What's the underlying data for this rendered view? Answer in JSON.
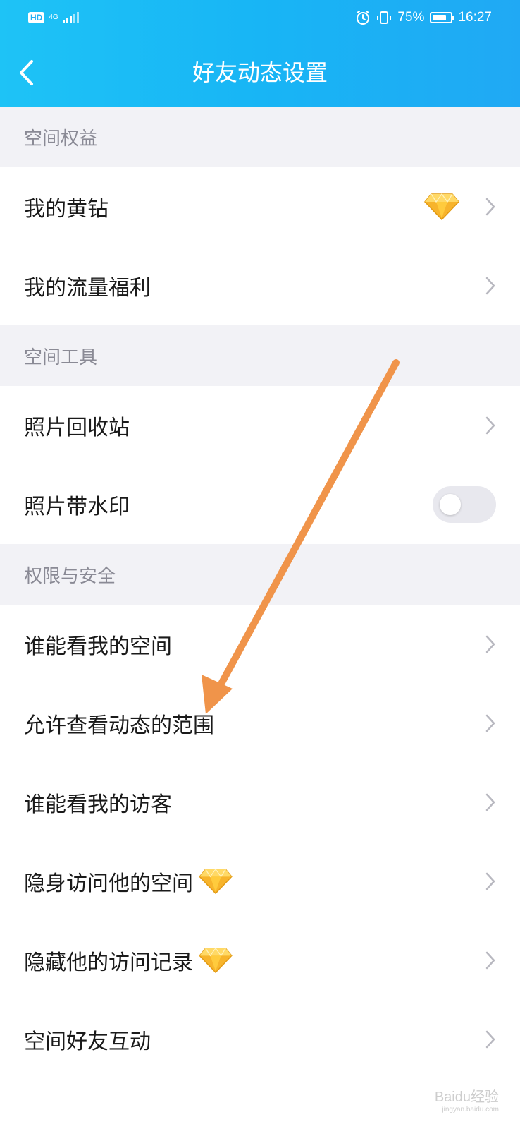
{
  "status_bar": {
    "hd": "HD",
    "network": "4G",
    "battery": "75%",
    "time": "16:27"
  },
  "header": {
    "title": "好友动态设置"
  },
  "sections": [
    {
      "title": "空间权益",
      "items": [
        {
          "label": "我的黄钻",
          "badge": "diamond-icon"
        },
        {
          "label": "我的流量福利"
        }
      ]
    },
    {
      "title": "空间工具",
      "items": [
        {
          "label": "照片回收站"
        },
        {
          "label": "照片带水印",
          "toggle": "off"
        }
      ]
    },
    {
      "title": "权限与安全",
      "items": [
        {
          "label": "谁能看我的空间"
        },
        {
          "label": "允许查看动态的范围"
        },
        {
          "label": "谁能看我的访客"
        },
        {
          "label": "隐身访问他的空间",
          "badge": "diamond-icon"
        },
        {
          "label": "隐藏他的访问记录",
          "badge": "diamond-icon"
        },
        {
          "label": "空间好友互动"
        }
      ]
    }
  ],
  "watermark": {
    "text": "Baidu经验",
    "url": "jingyan.baidu.com"
  },
  "colors": {
    "header_start": "#1ec3f6",
    "header_end": "#20a9f4",
    "section_bg": "#f2f2f6",
    "annotation_arrow": "#f0944a"
  }
}
